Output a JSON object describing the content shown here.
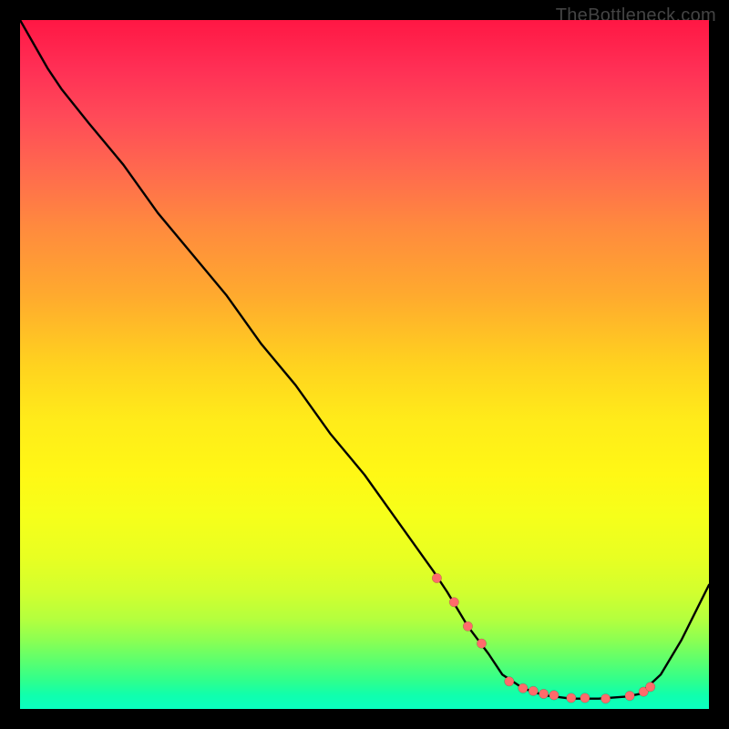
{
  "watermark": "TheBottleneck.com",
  "colors": {
    "background": "#000000",
    "curve": "#000000",
    "markers": "#ff6b6b"
  },
  "chart_data": {
    "type": "line",
    "title": "",
    "xlabel": "",
    "ylabel": "",
    "xlim": [
      0,
      100
    ],
    "ylim": [
      0,
      100
    ],
    "grid": false,
    "legend": false,
    "series": [
      {
        "name": "bottleneck-curve",
        "x": [
          0,
          4,
          6,
          10,
          15,
          20,
          25,
          30,
          35,
          40,
          45,
          50,
          55,
          60,
          62,
          65,
          68,
          70,
          73,
          76,
          80,
          84,
          88,
          90,
          93,
          96,
          100
        ],
        "y": [
          100,
          93,
          90,
          85,
          79,
          72,
          66,
          60,
          53,
          47,
          40,
          34,
          27,
          20,
          17,
          12,
          8,
          5,
          3,
          2,
          1.5,
          1.5,
          1.8,
          2.2,
          5,
          10,
          18
        ]
      }
    ],
    "markers": {
      "name": "highlight-points",
      "x": [
        60.5,
        63.0,
        65.0,
        67.0,
        71.0,
        73.0,
        74.5,
        76.0,
        77.5,
        80.0,
        82.0,
        85.0,
        88.5,
        90.5,
        91.5
      ],
      "y": [
        19.0,
        15.5,
        12.0,
        9.5,
        4.0,
        3.0,
        2.6,
        2.2,
        2.0,
        1.6,
        1.6,
        1.5,
        1.9,
        2.5,
        3.2
      ]
    }
  }
}
